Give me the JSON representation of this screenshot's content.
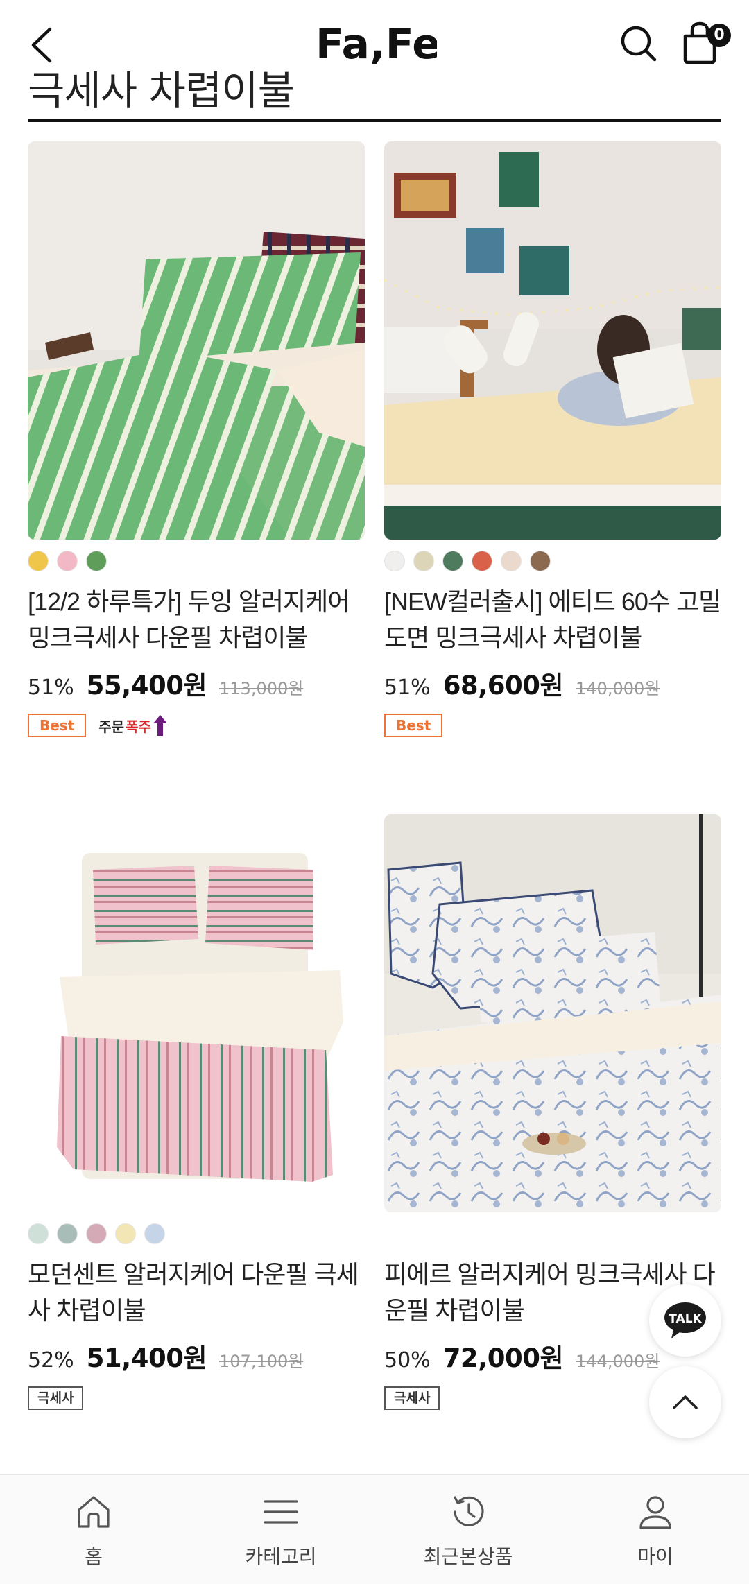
{
  "header": {
    "logo_text": "Fa,Fe",
    "cart_count": "0"
  },
  "section": {
    "title": "극세사 차렵이불"
  },
  "products": [
    {
      "name": "[12/2 하루특가] 두잉 알러지케어 밍크극세사 다운필 차렵이불",
      "discount": "51%",
      "price": "55,400원",
      "original_price": "113,000원",
      "swatches": [
        "#f0c64a",
        "#f2b8c6",
        "#5f9d5a"
      ],
      "badges": [
        {
          "type": "best",
          "label": "Best"
        },
        {
          "type": "hot",
          "label_a": "주문",
          "label_b": "폭주"
        }
      ]
    },
    {
      "name": "[NEW컬러출시] 에티드 60수 고밀도면 밍크극세사 차렵이불",
      "discount": "51%",
      "price": "68,600원",
      "original_price": "140,000원",
      "swatches": [
        "#f0efee",
        "#ddd5b8",
        "#4e7b5d",
        "#d9614a",
        "#ecd9cd",
        "#8c6a4f"
      ],
      "badges": [
        {
          "type": "best",
          "label": "Best"
        }
      ]
    },
    {
      "name": "모던센트 알러지케어 다운필 극세사 차렵이불",
      "discount": "52%",
      "price": "51,400원",
      "original_price": "107,100원",
      "swatches": [
        "#cfe0d8",
        "#a9bdb8",
        "#d4aab6",
        "#f2e6b5",
        "#c5d4e6"
      ],
      "badges": [
        {
          "type": "plain",
          "label": "극세사"
        }
      ]
    },
    {
      "name": "피에르 알러지케어 밍크극세사 다운필 차렵이불",
      "discount": "50%",
      "price": "72,000원",
      "original_price": "144,000원",
      "swatches": [],
      "badges": [
        {
          "type": "plain",
          "label": "극세사"
        }
      ]
    }
  ],
  "floating": {
    "talk_label": "TALK"
  },
  "bottom_nav": [
    {
      "label": "홈",
      "icon": "home-icon"
    },
    {
      "label": "카테고리",
      "icon": "menu-icon"
    },
    {
      "label": "최근본상품",
      "icon": "history-icon"
    },
    {
      "label": "마이",
      "icon": "user-icon"
    }
  ],
  "colors": {
    "best_badge": "#ec7333",
    "hot_red": "#d8262e",
    "hot_arrow": "#6c1c7d",
    "text": "#111111"
  }
}
